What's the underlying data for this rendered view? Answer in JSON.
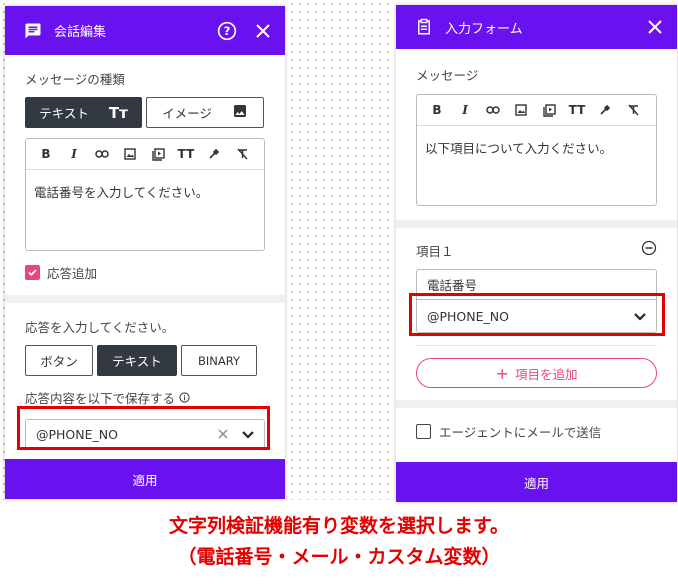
{
  "colors": {
    "header": "#6a11f0",
    "highlight": "#e30000",
    "pink": "#e8457b",
    "dark_tab": "#333940"
  },
  "left": {
    "title": "会話編集",
    "message_type_label": "メッセージの種類",
    "tabs": [
      {
        "label": "テキスト",
        "icon": "text-size-icon"
      },
      {
        "label": "イメージ",
        "icon": "image-icon"
      }
    ],
    "toolbar": [
      "bold-icon",
      "italic-icon",
      "link-icon",
      "image-icon",
      "video-icon",
      "text-size-icon",
      "color-picker-icon",
      "clear-format-icon"
    ],
    "editor_text": "電話番号を入力してください。",
    "add_response_label": "応答追加",
    "response_prompt": "応答を入力してください。",
    "response_types": [
      "ボタン",
      "テキスト",
      "BINARY"
    ],
    "save_as_label": "応答内容を以下で保存する",
    "variable_value": "@PHONE_NO",
    "apply_label": "適用"
  },
  "right": {
    "title": "入力フォーム",
    "message_label": "メッセージ",
    "toolbar": [
      "bold-icon",
      "italic-icon",
      "link-icon",
      "image-icon",
      "video-icon",
      "text-size-icon",
      "color-picker-icon",
      "clear-format-icon"
    ],
    "editor_text": "以下項目について入力ください。",
    "item_label": "項目１",
    "item_name": "電話番号",
    "variable_value": "@PHONE_NO",
    "add_item_label": "項目を追加",
    "email_agent_label": "エージェントにメールで送信",
    "apply_label": "適用"
  },
  "caption": {
    "line1": "文字列検証機能有り変数を選択します。",
    "line2": "（電話番号・メール・カスタム変数）"
  }
}
